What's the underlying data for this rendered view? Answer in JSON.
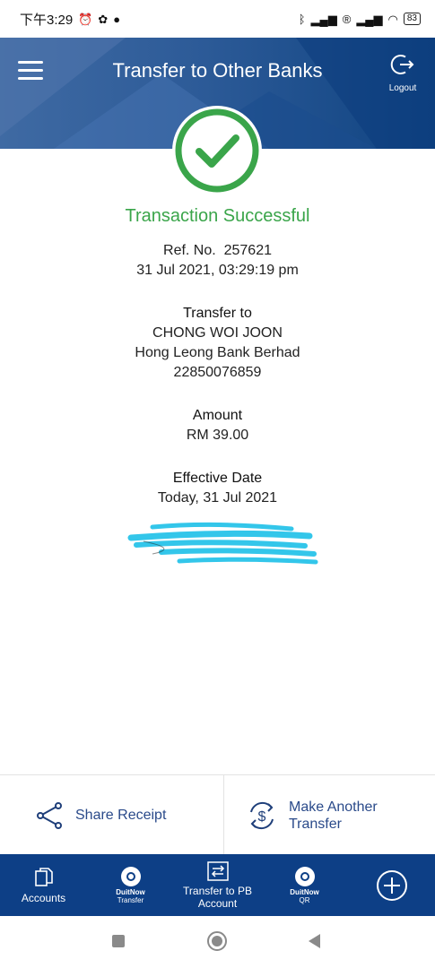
{
  "status_bar": {
    "time": "下午3:29",
    "battery": "83"
  },
  "header": {
    "title": "Transfer to Other Banks",
    "logout_label": "Logout"
  },
  "result": {
    "title": "Transaction Successful",
    "ref_line": "Ref. No.  257621",
    "datetime": "31 Jul 2021, 03:29:19 pm"
  },
  "transfer_to": {
    "label": "Transfer to",
    "name": "CHONG WOI JOON",
    "bank": "Hong Leong Bank Berhad",
    "account": "22850076859"
  },
  "amount": {
    "label": "Amount",
    "value": "RM 39.00"
  },
  "effective_date": {
    "label": "Effective Date",
    "value": "Today, 31 Jul 2021"
  },
  "actions": {
    "share_label": "Share Receipt",
    "another_line1": "Make Another",
    "another_line2": "Transfer"
  },
  "bottom_nav": {
    "accounts": "Accounts",
    "duitnow_transfer_title": "DuitNow",
    "duitnow_transfer_sub": "Transfer",
    "transfer_pb_line1": "Transfer to PB",
    "transfer_pb_line2": "Account",
    "duitnow_qr_title": "DuitNow",
    "duitnow_qr_sub": "QR"
  },
  "colors": {
    "header": "#0d3f86",
    "success": "#3aa54a",
    "accent_text": "#2a4a8a",
    "redaction": "#33c6ea"
  },
  "icons": [
    "alarm-icon",
    "bluetooth-icon",
    "signal-icon",
    "wifi-icon",
    "battery-icon",
    "menu-icon",
    "logout-icon",
    "check-icon",
    "share-icon",
    "dollar-refresh-icon",
    "documents-icon",
    "duitnow-icon",
    "transfer-arrows-icon",
    "plus-circle-icon",
    "square-icon",
    "circle-icon",
    "back-icon"
  ]
}
